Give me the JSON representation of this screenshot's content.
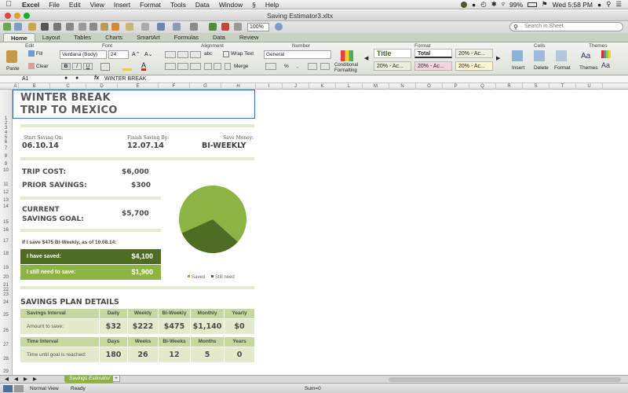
{
  "menubar": {
    "app": "Excel",
    "items": [
      "File",
      "Edit",
      "View",
      "Insert",
      "Format",
      "Tools",
      "Data",
      "Window",
      "Help"
    ],
    "battery": "99%",
    "clock": "Wed 5:58 PM"
  },
  "window": {
    "title": "Saving Estimator3.xltx"
  },
  "toolbar": {
    "zoom": "100%",
    "search_placeholder": "Search in Sheet"
  },
  "ribbon": {
    "tabs": [
      "Home",
      "Layout",
      "Tables",
      "Charts",
      "SmartArt",
      "Formulas",
      "Data",
      "Review"
    ],
    "groups": {
      "edit": "Edit",
      "font": "Font",
      "alignment": "Alignment",
      "number": "Number",
      "format": "Format",
      "cells": "Cells",
      "themes": "Themes"
    },
    "paste": "Paste",
    "fill": "Fill",
    "clear": "Clear",
    "font_name": "Verdana (Body)",
    "font_size": "24",
    "bold": "B",
    "italic": "I",
    "underline": "U",
    "wrap_text": "Wrap Text",
    "abc": "abc",
    "merge": "Merge",
    "number_format": "General",
    "percent": "%",
    "comma": ",",
    "conditional_formatting": "Conditional Formatting",
    "styles": {
      "title": "Title",
      "total": "Total",
      "accent1": "20% - Ac...",
      "accent2": "20% - Ac...",
      "accent3": "20% - Ac...",
      "accent4": "20% - Ac..."
    },
    "insert": "Insert",
    "delete": "Delete",
    "format_btn": "Format",
    "themes_btn": "Themes",
    "aa": "Aa"
  },
  "formula_bar": {
    "cell": "A1",
    "fx": "fx",
    "content": "WINTER BREAK"
  },
  "columns": [
    "A",
    "B",
    "C",
    "D",
    "E",
    "F",
    "G",
    "H",
    "I",
    "J",
    "K",
    "L",
    "M",
    "N",
    "O",
    "P",
    "Q",
    "R",
    "S",
    "T",
    "U"
  ],
  "rows": [
    "1",
    "2",
    "3",
    "4",
    "5",
    "6",
    "7",
    "8",
    "9",
    "10",
    "11",
    "12",
    "13",
    "14",
    "15",
    "16",
    "17",
    "18",
    "19",
    "20",
    "21",
    "22",
    "23",
    "24",
    "25",
    "26",
    "27",
    "28",
    "29"
  ],
  "sheet": {
    "title_line1": "WINTER BREAK",
    "title_line2": "TRIP TO MEXICO",
    "start_label": "Start Saving On:",
    "start_value": "06.10.14",
    "finish_label": "Finish Saving By:",
    "finish_value": "12.07.14",
    "save_label": "Save Money:",
    "save_value": "BI-WEEKLY",
    "trip_cost_label": "TRIP COST:",
    "trip_cost_value": "$6,000",
    "prior_label": "PRIOR SAVINGS:",
    "prior_value": "$300",
    "goal_label_1": "CURRENT",
    "goal_label_2": "SAVINGS GOAL:",
    "goal_value": "$5,700",
    "if_save": "If I save $475 Bi-Weekly, as of 10.08.14:",
    "have_saved_label": "I have saved:",
    "have_saved_value": "$4,100",
    "still_need_label": "I still need to save:",
    "still_need_value": "$1,900",
    "plan_title": "SAVINGS PLAN DETAILS",
    "interval_header": "Savings Interval",
    "interval_cols": [
      "Daily",
      "Weekly",
      "Bi-Weekly",
      "Monthly",
      "Yearly"
    ],
    "amount_label": "Amount to save:",
    "amount_values": [
      "$32",
      "$222",
      "$475",
      "$1,140",
      "$0"
    ],
    "time_header": "Time Interval",
    "time_cols": [
      "Days",
      "Weeks",
      "Bi-Weeks",
      "Months",
      "Years"
    ],
    "time_label": "Time until goal is reached:",
    "time_values": [
      "180",
      "26",
      "12",
      "5",
      "0"
    ]
  },
  "chart_data": {
    "type": "pie",
    "categories": [
      "Saved",
      "Still need"
    ],
    "values": [
      4100,
      1900
    ],
    "colors": [
      "#8cb443",
      "#4e6c22"
    ],
    "legend": "bottom"
  },
  "sheet_tab": "Savings Estimator",
  "add_tab": "+",
  "status": {
    "view": "Normal View",
    "ready": "Ready",
    "sum": "Sum=0"
  }
}
